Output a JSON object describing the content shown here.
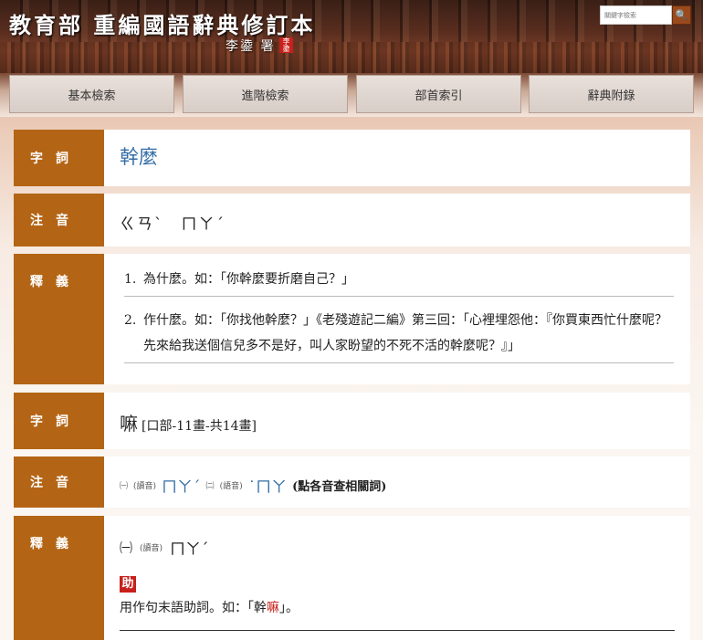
{
  "header": {
    "title": "教育部 重編國語辭典修訂本",
    "subtitle": "李鍌 署",
    "seal": "李鍌",
    "search_placeholder": "關鍵字檢索",
    "search_icon": "🔍"
  },
  "nav": {
    "tabs": [
      "基本檢索",
      "進階檢索",
      "部首索引",
      "辭典附錄"
    ]
  },
  "entry1": {
    "label_word": "字　詞",
    "word": "幹麼",
    "label_zhuyin": "注　音",
    "zhuyin": "ㄍㄢˋ　ㄇㄚˊ",
    "label_def": "釋　義",
    "defs": [
      {
        "n": "1.",
        "text": "為什麼。如：「你幹麼要折磨自己？」"
      },
      {
        "n": "2.",
        "text": "作什麼。如：「你找他幹麼？」《老殘遊記二編》第三回：「心裡埋怨他：『你買東西忙什麼呢？先來給我送個信兒多不是好，叫人家盼望的不死不活的幹麼呢？』」"
      }
    ]
  },
  "entry2": {
    "label_word": "字　詞",
    "word": "嘛",
    "info": "[口部-11畫-共14畫]",
    "label_zhuyin": "注　音",
    "z1_num": "㈠",
    "z1_tag": "(讀音)",
    "z1": "ㄇㄚˊ",
    "z2_num": "㈡",
    "z2_tag": "(語音)",
    "z2": "˙ㄇㄚ",
    "z_note": "(點各音查相關詞)",
    "label_def": "釋　義",
    "d_num": "㈠",
    "d_tag": "(讀音)",
    "d_zhuyin": "ㄇㄚˊ",
    "pos": "助",
    "example_pre": "用作句末語助詞。如：「幹",
    "example_red": "嘛",
    "example_post": "」。"
  }
}
